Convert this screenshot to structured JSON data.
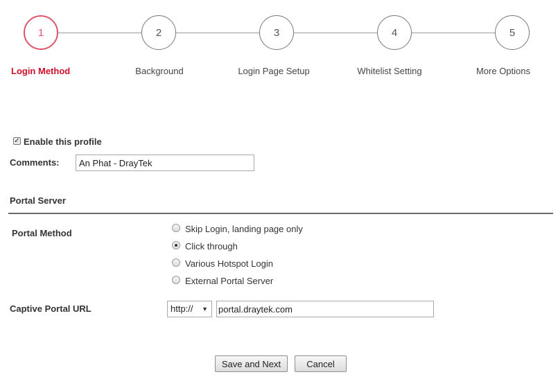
{
  "wizard": {
    "steps": [
      {
        "number": "1",
        "label": "Login Method"
      },
      {
        "number": "2",
        "label": "Background"
      },
      {
        "number": "3",
        "label": "Login Page Setup"
      },
      {
        "number": "4",
        "label": "Whitelist Setting"
      },
      {
        "number": "5",
        "label": "More Options"
      }
    ],
    "active_step": 1,
    "active_color": "#d0102a"
  },
  "profile": {
    "enable_label": "Enable this profile",
    "enable_checked": true,
    "comments_label": "Comments:",
    "comments_value": "An Phat - DrayTek"
  },
  "portal_server": {
    "section_title": "Portal Server",
    "method_label": "Portal Method",
    "options": [
      "Skip Login, landing page only",
      "Click through",
      "Various Hotspot Login",
      "External Portal Server"
    ],
    "selected_option": "Click through",
    "url_label": "Captive Portal URL",
    "protocol_value": "http://",
    "url_value": "portal.draytek.com"
  },
  "buttons": {
    "save_next": "Save and Next",
    "cancel": "Cancel"
  }
}
